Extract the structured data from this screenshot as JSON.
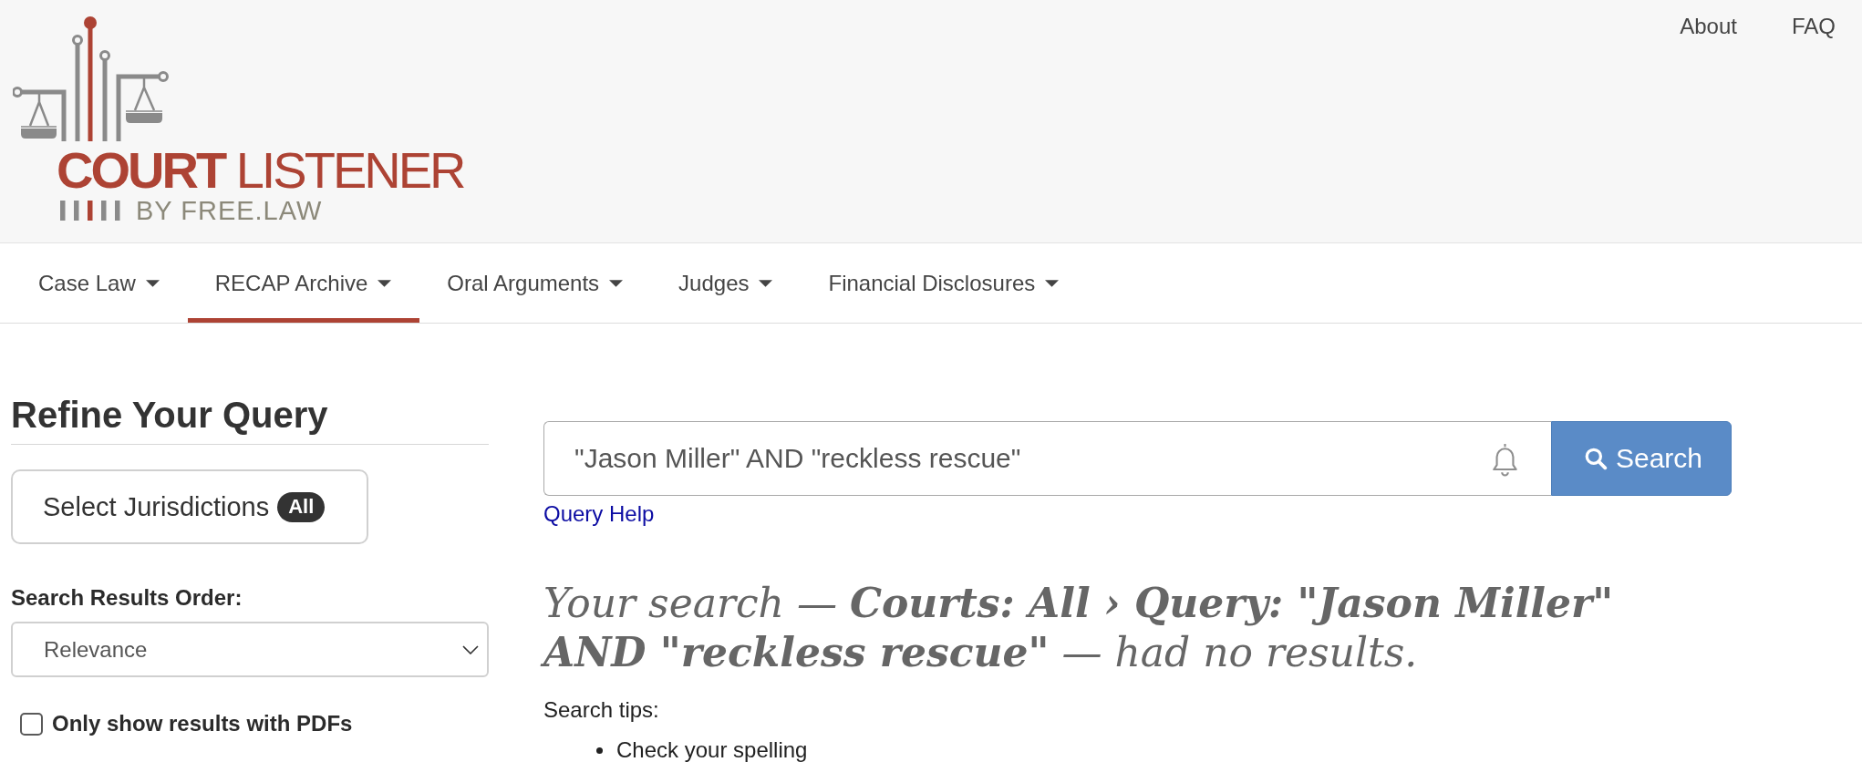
{
  "header": {
    "logo": {
      "title": "**COURT** LISTENER",
      "tagline": "BY FREE.LAW"
    },
    "links": [
      "About",
      "FAQ"
    ]
  },
  "nav": {
    "tabs": [
      {
        "label": "Case Law",
        "selected": false
      },
      {
        "label": "RECAP Archive",
        "selected": true
      },
      {
        "label": "Oral Arguments",
        "selected": false
      },
      {
        "label": "Judges",
        "selected": false
      },
      {
        "label": "Financial Disclosures",
        "selected": false
      }
    ]
  },
  "sidebar": {
    "title": "Refine Your Query",
    "jurisdictions": {
      "label": "Select Jurisdictions",
      "badge": "All"
    },
    "order": {
      "label": "Search Results Order:",
      "value": "Relevance"
    },
    "pdf_filter": {
      "label": "Only show results with PDFs",
      "checked": false
    }
  },
  "search": {
    "query": "\"Jason Miller\" AND \"reckless rescue\"",
    "button": "Search",
    "help_link": "Query Help"
  },
  "results": {
    "message": "Your search — **Courts: All › Query: \"Jason Miller\" AND \"reckless rescue\"** — had no results.",
    "tips_title": "Search tips:",
    "tips": [
      "Check your spelling"
    ]
  }
}
